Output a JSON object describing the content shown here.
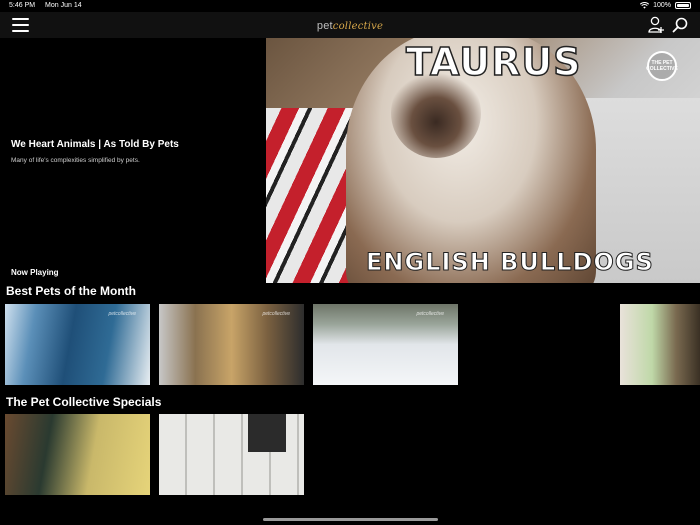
{
  "status_bar": {
    "time": "5:46 PM",
    "date": "Mon Jun 14",
    "battery": "100%"
  },
  "header": {
    "logo_part1": "pet",
    "logo_part2": "collective",
    "icons": {
      "menu": "hamburger-icon",
      "account": "add-user-icon",
      "search": "search-icon"
    }
  },
  "hero": {
    "title": "We Heart Animals | As Told By Pets",
    "description": "Many of life's complexities simplified by pets.",
    "now_playing_label": "Now Playing",
    "video": {
      "title_text": "TAURUS",
      "subtitle_text": "ENGLISH BULLDOGS",
      "badge_text": "THE PET COLLECTIVE"
    }
  },
  "rows": [
    {
      "title": "Best Pets of the Month",
      "thumbnails": [
        {
          "watermark": "petcollective"
        },
        {
          "watermark": "petcollective"
        },
        {
          "watermark": "petcollective"
        },
        {
          "watermark": ""
        }
      ]
    },
    {
      "title": "The Pet Collective Specials",
      "thumbnails": [
        {
          "watermark": ""
        },
        {
          "watermark": ""
        }
      ]
    }
  ],
  "colors": {
    "background": "#000000",
    "navbar": "#111111",
    "logo_accent": "#d8a84a"
  }
}
